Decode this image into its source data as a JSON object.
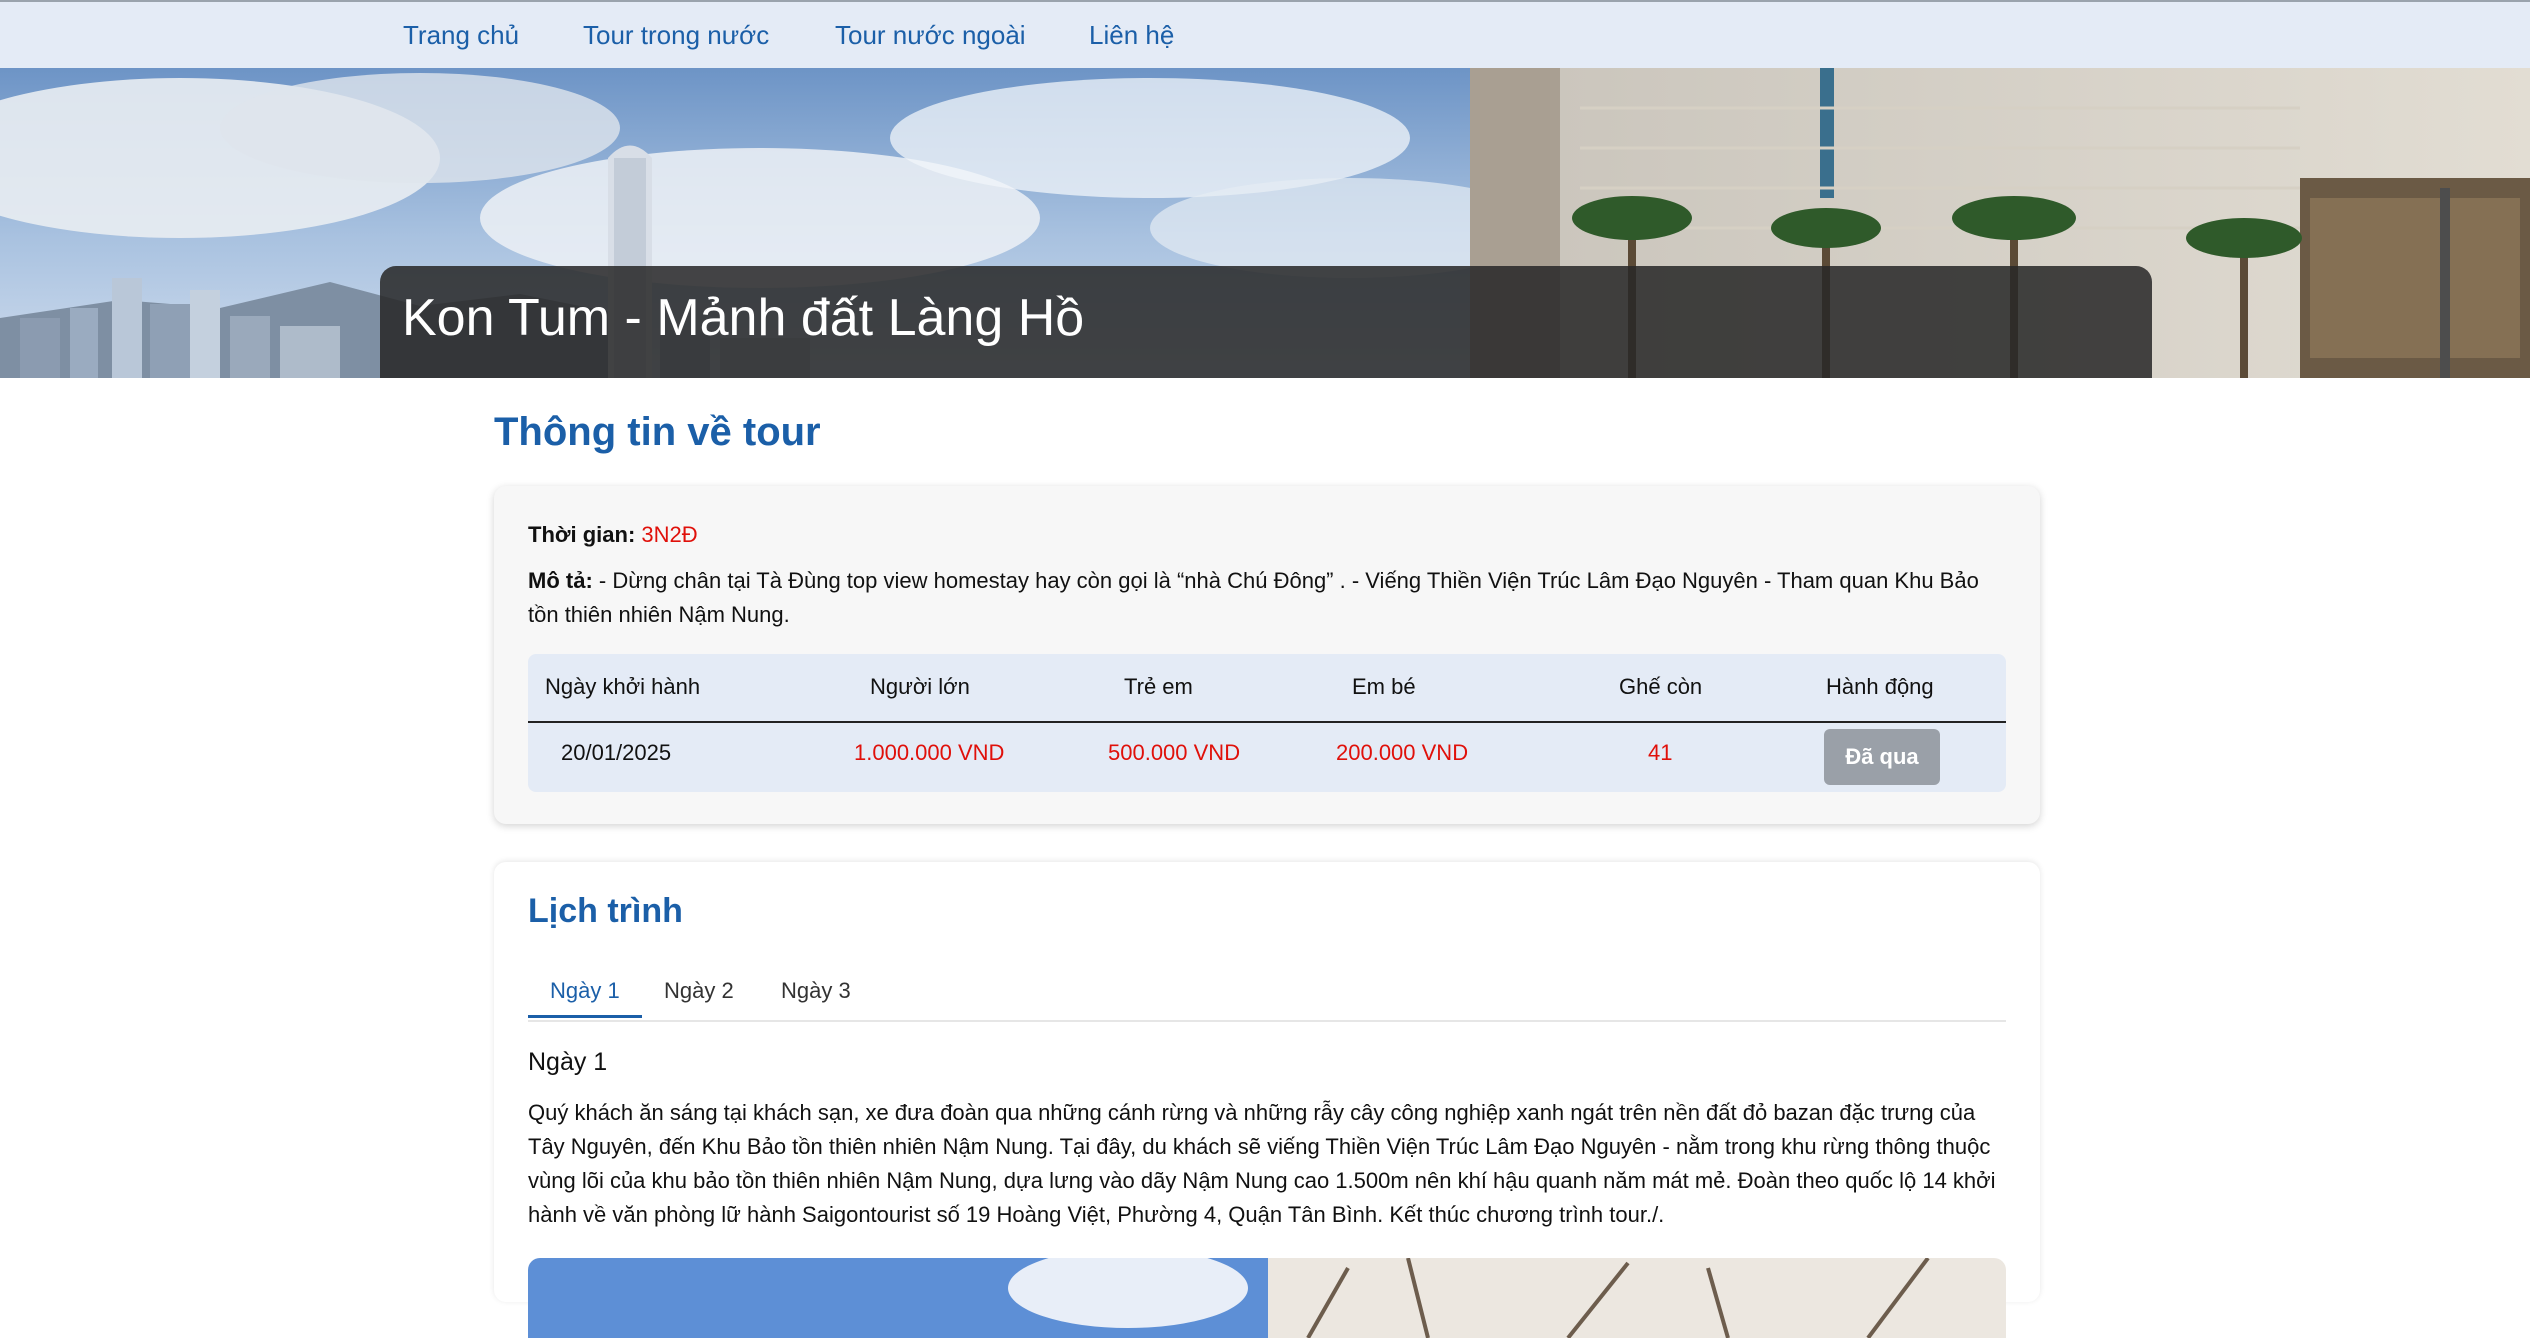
{
  "nav": {
    "items": [
      "Trang chủ",
      "Tour trong nước",
      "Tour nước ngoài",
      "Liên hệ"
    ]
  },
  "hero": {
    "title": "Kon Tum - Mảnh đất Làng Hồ"
  },
  "tour_info": {
    "heading": "Thông tin về tour",
    "duration_label": "Thời gian:",
    "duration_value": "3N2Đ",
    "description_label": "Mô tả:",
    "description_text": "- Dừng chân tại Tà Đùng top view homestay hay còn gọi là “nhà Chú Đông” . - Viếng Thiền Viện Trúc Lâm Đạo Nguyên - Tham quan Khu Bảo tồn thiên nhiên Nậm Nung."
  },
  "departures": {
    "headers": [
      "Ngày khởi hành",
      "Người lớn",
      "Trẻ em",
      "Em bé",
      "Ghế còn",
      "Hành động"
    ],
    "rows": [
      {
        "date": "20/01/2025",
        "adult": "1.000.000 VND",
        "child": "500.000 VND",
        "baby": "200.000 VND",
        "seats": "41",
        "action": "Đã qua"
      }
    ]
  },
  "itinerary": {
    "heading": "Lịch trình",
    "tabs": [
      "Ngày 1",
      "Ngày 2",
      "Ngày 3"
    ],
    "active_tab": "Ngày 1",
    "day_title": "Ngày 1",
    "day_text": "Quý khách ăn sáng tại khách sạn, xe đưa đoàn qua những cánh rừng và những rẫy cây công nghiệp xanh ngát trên nền đất đỏ bazan đặc trưng của Tây Nguyên, đến Khu Bảo tồn thiên nhiên Nậm Nung. Tại đây, du khách sẽ viếng Thiền Viện Trúc Lâm Đạo Nguyên - nằm trong khu rừng thông thuộc vùng lõi của khu bảo tồn thiên nhiên Nậm Nung, dựa lưng vào dãy Nậm Nung cao 1.500m nên khí hậu quanh năm mát mẻ. Đoàn theo quốc lộ 14 khởi hành về văn phòng lữ hành Saigontourist số 19 Hoàng Việt, Phường 4, Quận Tân Bình. Kết thúc chương trình tour./."
  },
  "colors": {
    "accent": "#1b5fa8",
    "price_red": "#e0100a",
    "nav_bg": "#e4ebf6",
    "button_disabled": "#9aa0a8"
  }
}
